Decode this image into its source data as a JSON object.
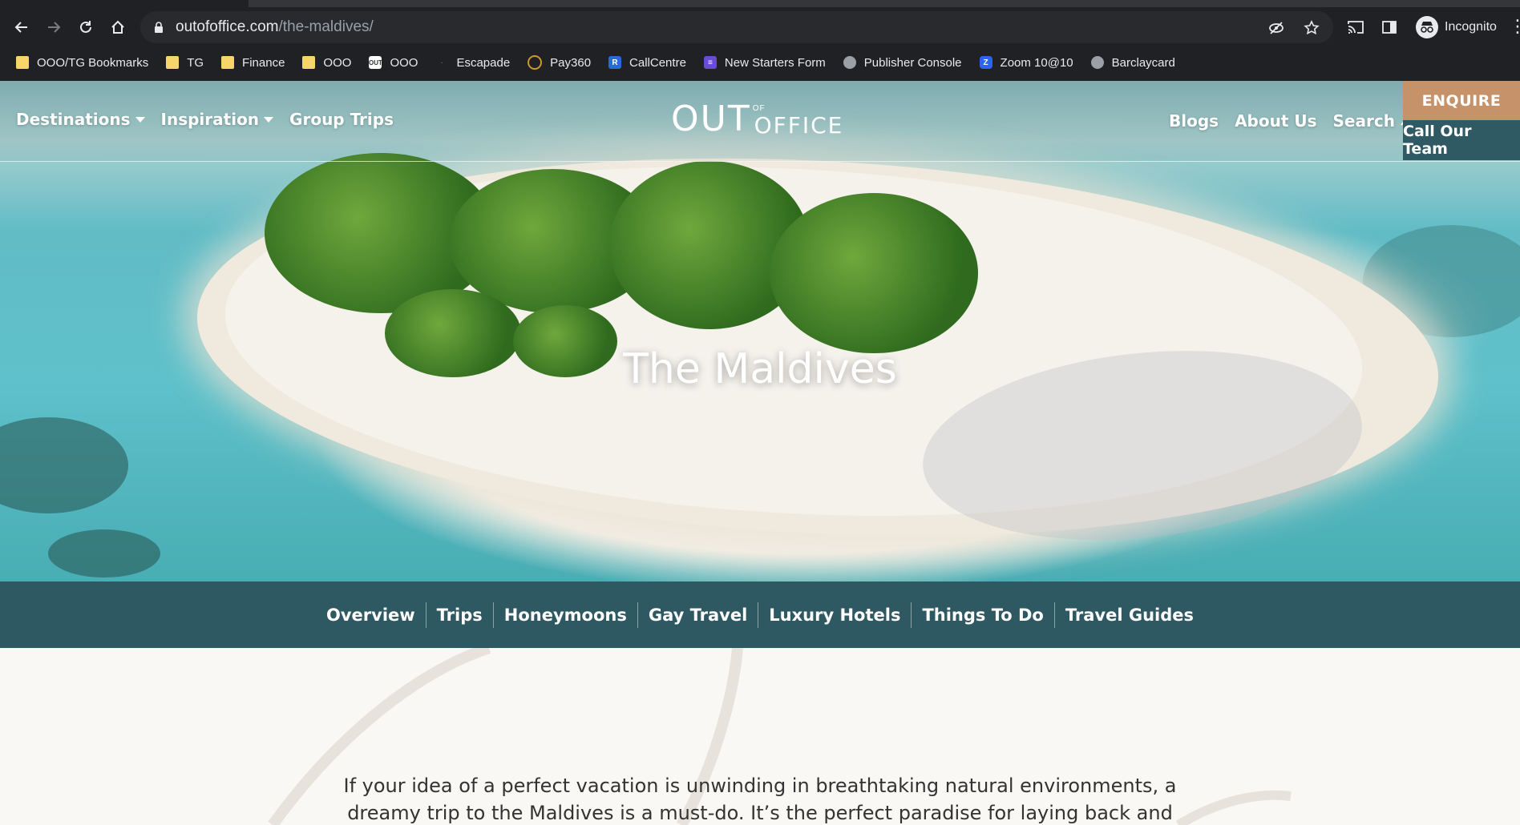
{
  "browser": {
    "url_host": "outofoffice.com",
    "url_path": "/the-maldives/",
    "incognito_label": "Incognito",
    "icons": {
      "back": "arrow-left-icon",
      "forward": "arrow-right-icon",
      "reload": "reload-icon",
      "home": "home-icon",
      "lock": "lock-icon",
      "eye_off": "eye-off-icon",
      "star": "star-icon",
      "cast": "cast-icon",
      "side_panel": "side-panel-icon",
      "menu": "kebab-menu-icon"
    }
  },
  "bookmarks": [
    {
      "label": "OOO/TG Bookmarks",
      "icon": "folder-icon"
    },
    {
      "label": "TG",
      "icon": "folder-icon"
    },
    {
      "label": "Finance",
      "icon": "folder-icon"
    },
    {
      "label": "OOO",
      "icon": "folder-icon"
    },
    {
      "label": "OOO",
      "icon": "out-favicon"
    },
    {
      "label": "Escapade",
      "icon": "escapade-favicon"
    },
    {
      "label": "Pay360",
      "icon": "pay360-favicon"
    },
    {
      "label": "CallCentre",
      "icon": "callcentre-favicon"
    },
    {
      "label": "New Starters Form",
      "icon": "form-favicon"
    },
    {
      "label": "Publisher Console",
      "icon": "globe-icon"
    },
    {
      "label": "Zoom 10@10",
      "icon": "zoom-favicon"
    },
    {
      "label": "Barclaycard",
      "icon": "globe-icon"
    }
  ],
  "site_header": {
    "nav_left": [
      "Destinations",
      "Inspiration",
      "Group Trips"
    ],
    "logo": {
      "out": "OUT",
      "of": "OF",
      "office": "OFFICE"
    },
    "nav_right": [
      "Blogs",
      "About Us",
      "Search"
    ],
    "enquire_label": "ENQUIRE",
    "call_label": "Call Our Team",
    "colors": {
      "enquire_bg": "#c6926a",
      "call_bg": "#2f5a63"
    }
  },
  "hero": {
    "title": "The Maldives"
  },
  "subnav": [
    "Overview",
    "Trips",
    "Honeymoons",
    "Gay Travel",
    "Luxury Hotels",
    "Things To Do",
    "Travel Guides"
  ],
  "intro": {
    "text": "If your idea of a perfect vacation is unwinding in breathtaking natural environments, a dreamy trip to the Maldives is a must-do. It’s the perfect paradise for laying back and switching off. The"
  },
  "colors": {
    "subnav_bg": "#2e5963",
    "page_bg": "#faf8f4",
    "browser_bg": "#202124"
  }
}
